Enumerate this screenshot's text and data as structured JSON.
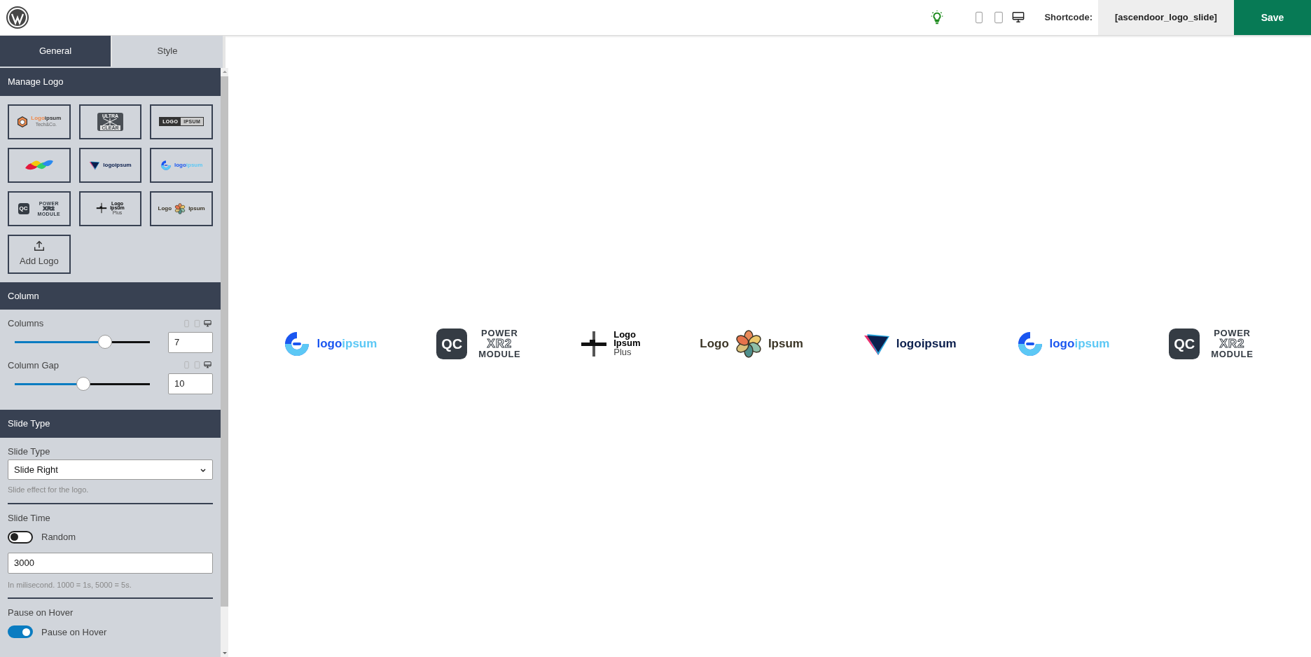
{
  "header": {
    "shortcode_label": "Shortcode:",
    "shortcode": "[ascendoor_logo_slide]",
    "save": "Save",
    "devices": [
      {
        "kind": "mobile",
        "selected": false
      },
      {
        "kind": "tablet",
        "selected": false
      },
      {
        "kind": "desktop",
        "selected": true
      }
    ]
  },
  "tabs": [
    {
      "label": "General",
      "selected": true
    },
    {
      "label": "Style",
      "selected": false
    }
  ],
  "manage_logo": {
    "title": "Manage Logo",
    "add_label": "Add Logo",
    "logos": [
      {
        "kind": "hex",
        "words": [
          "Logo",
          "ipsum",
          "Tech&Co."
        ]
      },
      {
        "kind": "ultra",
        "words": [
          "ULTRA",
          "CLEAR"
        ]
      },
      {
        "kind": "box",
        "words": [
          "LOGO",
          "IPSUM"
        ]
      },
      {
        "kind": "petals"
      },
      {
        "kind": "triangle",
        "words": [
          "logoipsum"
        ]
      },
      {
        "kind": "ring",
        "words": [
          "logo",
          "ipsum"
        ]
      },
      {
        "kind": "qc",
        "words": [
          "QC",
          "POWER",
          "XR2",
          "MODULE"
        ]
      },
      {
        "kind": "cross",
        "words": [
          "Logo",
          "Ipsum",
          "Plus"
        ]
      },
      {
        "kind": "flower",
        "words": [
          "Logo",
          "Ipsum"
        ]
      }
    ]
  },
  "column": {
    "title": "Column",
    "sliders": [
      {
        "label": "Columns",
        "level": 0.67,
        "value": "7",
        "devices": [
          {
            "kind": "mobile",
            "selected": false
          },
          {
            "kind": "tablet",
            "selected": false
          },
          {
            "kind": "desktop",
            "selected": true
          }
        ]
      },
      {
        "label": "Column Gap",
        "level": 0.51,
        "value": "10",
        "devices": [
          {
            "kind": "mobile",
            "selected": false
          },
          {
            "kind": "tablet",
            "selected": false
          },
          {
            "kind": "desktop",
            "selected": true
          }
        ]
      }
    ]
  },
  "slide_type": {
    "title": "Slide Type",
    "type_label": "Slide Type",
    "type_value": "Slide Right",
    "type_hint": "Slide effect for the logo.",
    "time_label": "Slide Time",
    "random": {
      "label": "Random",
      "on": false
    },
    "time_value": "3000",
    "time_hint": "In milisecond. 1000 = 1s, 5000 = 5s.",
    "pause_label": "Pause on Hover",
    "pause": {
      "label": "Pause on Hover",
      "on": true
    }
  },
  "preview": {
    "logos": [
      {
        "kind": "ring",
        "words": [
          "logo",
          "ipsum"
        ]
      },
      {
        "kind": "qc",
        "words": [
          "QC",
          "POWER",
          "XR2",
          "MODULE"
        ]
      },
      {
        "kind": "cross",
        "words": [
          "Logo",
          "Ipsum",
          "Plus"
        ]
      },
      {
        "kind": "flower",
        "words": [
          "Logo",
          "Ipsum"
        ]
      },
      {
        "kind": "triangle",
        "words": [
          "logoipsum"
        ]
      },
      {
        "kind": "ring",
        "words": [
          "logo",
          "ipsum"
        ]
      },
      {
        "kind": "qc",
        "words": [
          "QC",
          "POWER",
          "XR2",
          "MODULE"
        ]
      }
    ]
  }
}
